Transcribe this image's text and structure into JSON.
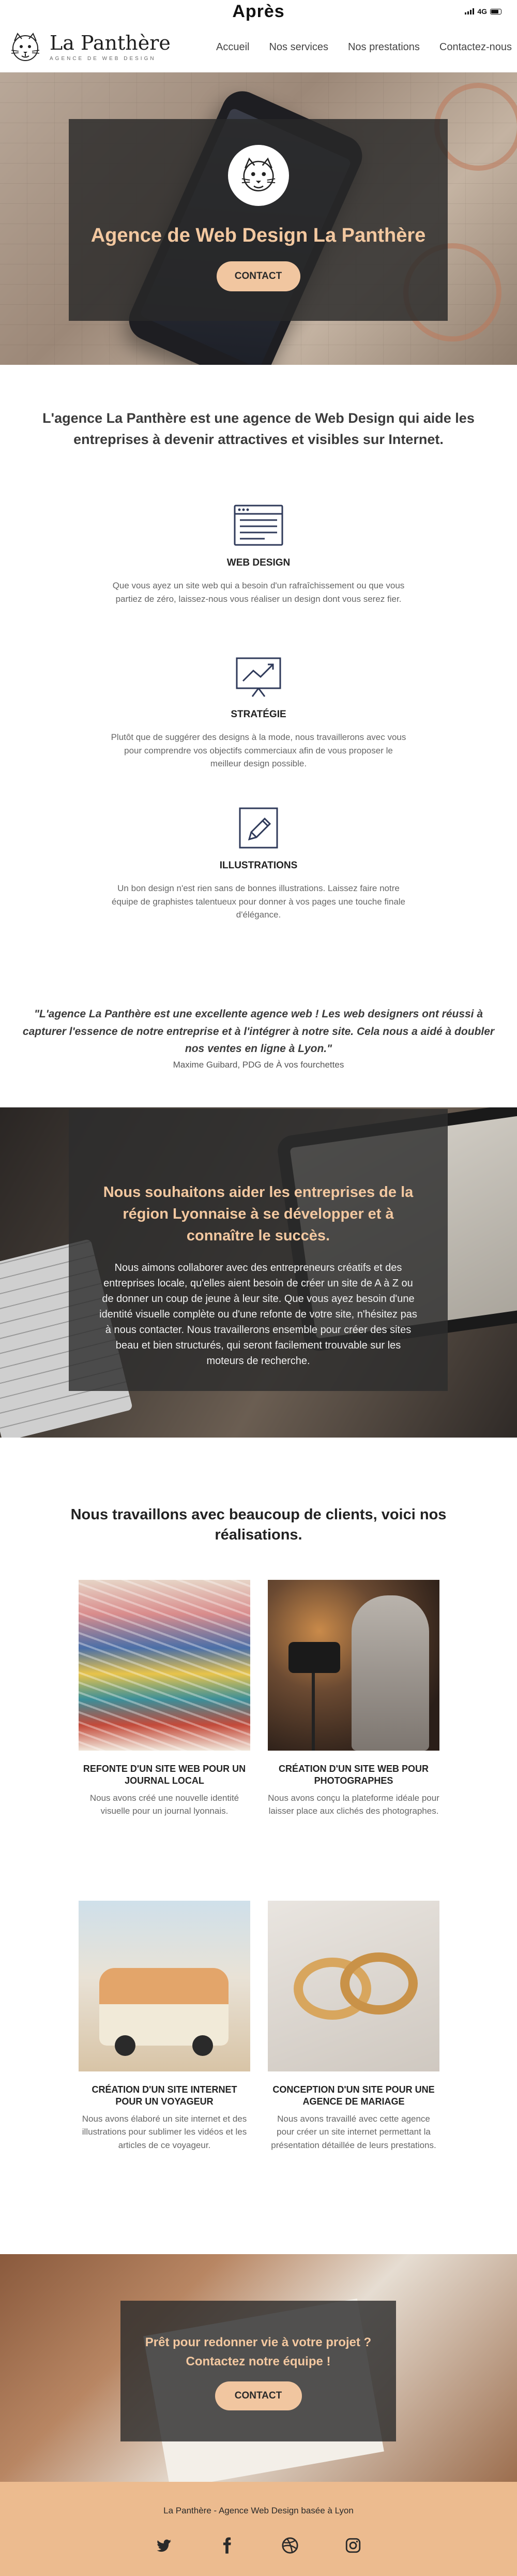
{
  "top_label": "Après",
  "status_bar": {
    "network": "4G"
  },
  "nav": {
    "brand_name": "La Panthère",
    "brand_tagline": "AGENCE DE WEB DESIGN",
    "menu": [
      "Accueil",
      "Nos services",
      "Nos prestations",
      "Contactez-nous"
    ]
  },
  "hero": {
    "title": "Agence de Web Design La Panthère",
    "button": "CONTACT"
  },
  "intro": "L'agence La Panthère est une agence de Web Design qui aide les entreprises à devenir attractives et visibles sur Internet.",
  "services": [
    {
      "icon": "browser-window-icon",
      "title": "WEB DESIGN",
      "text": "Que vous ayez un site web qui a besoin d'un rafraîchissement ou que vous partiez de zéro, laissez-nous vous réaliser un design dont vous serez fier."
    },
    {
      "icon": "strategy-chart-icon",
      "title": "STRATÉGIE",
      "text": "Plutôt que de suggérer des designs à la mode, nous travaillerons avec vous pour comprendre vos objectifs commerciaux afin de vous proposer le meilleur design possible."
    },
    {
      "icon": "pencil-edit-icon",
      "title": "ILLUSTRATIONS",
      "text": "Un bon design n'est rien sans de bonnes illustrations. Laissez faire notre équipe de graphistes talentueux pour donner à vos pages une touche finale d'élégance."
    }
  ],
  "testimonial": {
    "quote": "\"L'agence La Panthère est une excellente agence web ! Les web designers ont réussi à capturer l'essence de notre entreprise et à l'intégrer à notre site. Cela nous a aidé à doubler nos ventes en ligne à Lyon.\"",
    "author": "Maxime Guibard, PDG de À vos fourchettes"
  },
  "mission": {
    "title": "Nous souhaitons aider les entreprises de la région Lyonnaise à se développer et à connaître le succès.",
    "text": "Nous aimons collaborer avec des entrepreneurs créatifs et des entreprises locale, qu'elles aient besoin de créer un site de A à Z ou de donner un coup de jeune à leur site. Que vous ayez besoin d'une identité visuelle complète ou d'une refonte de votre site, n'hésitez pas à nous contacter. Nous travaillerons ensemble pour créer des sites beau et bien structurés, qui seront facilement trouvable sur les moteurs de recherche."
  },
  "clients": {
    "title": "Nous travaillons avec beaucoup de clients, voici nos réalisations.",
    "cards": [
      {
        "title": "REFONTE D'UN SITE WEB POUR UN JOURNAL LOCAL",
        "text": "Nous avons créé une nouvelle identité visuelle pour un journal lyonnais."
      },
      {
        "title": "CRÉATION D'UN SITE WEB POUR PHOTOGRAPHES",
        "text": "Nous avons conçu la plateforme idéale pour laisser place aux clichés des photographes."
      },
      {
        "title": "CRÉATION D'UN SITE INTERNET POUR UN VOYAGEUR",
        "text": "Nous avons élaboré un site internet et des illustrations pour sublimer les vidéos et les articles de ce voyageur."
      },
      {
        "title": "CONCEPTION D'UN SITE POUR UNE AGENCE DE MARIAGE",
        "text": "Nous avons travaillé avec cette agence pour créer un site internet permettant la présentation détaillée de leurs prestations."
      }
    ]
  },
  "cta": {
    "title": "Prêt pour redonner vie à votre projet ? Contactez notre équipe !",
    "button": "CONTACT"
  },
  "footer": {
    "text": "La Panthère - Agence Web Design basée à Lyon",
    "social": [
      "twitter-icon",
      "facebook-icon",
      "dribbble-icon",
      "instagram-icon"
    ]
  },
  "colors": {
    "accent": "#f1c6a0",
    "heading_accent": "#f3c8a0",
    "footer_bg": "#ecbb8f",
    "icon_navy": "#2f3a5a"
  }
}
